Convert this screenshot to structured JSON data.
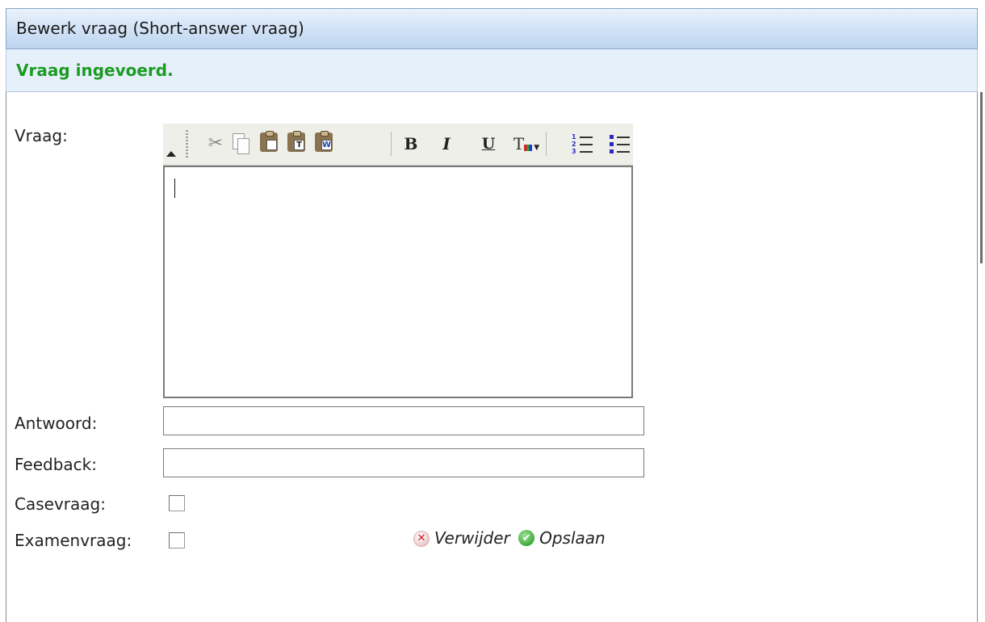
{
  "window": {
    "title": "Bewerk vraag (Short-answer vraag)"
  },
  "status": {
    "message": "Vraag ingevoerd.",
    "color": "#1c9b22"
  },
  "form": {
    "vraag_label": "Vraag:",
    "antwoord_label": "Antwoord:",
    "antwoord_value": "",
    "feedback_label": "Feedback:",
    "feedback_value": "",
    "casevraag_label": "Casevraag:",
    "casevraag_checked": false,
    "examenvraag_label": "Examenvraag:",
    "examenvraag_checked": false
  },
  "editor": {
    "content": "",
    "toolbar": {
      "collapse": "collapse-toolbar-icon",
      "cut": "cut-icon",
      "copy": "copy-icon",
      "paste": "paste-icon",
      "paste_text": "paste-text-icon",
      "paste_word": "paste-word-icon",
      "bold": "B",
      "italic": "I",
      "underline": "U",
      "text_color": "T",
      "ordered_list": "ordered-list-icon",
      "unordered_list": "unordered-list-icon"
    }
  },
  "actions": {
    "delete_label": "Verwijder",
    "save_label": "Opslaan",
    "delete_icon": "delete-icon",
    "save_icon": "save-check-icon",
    "delete_glyph": "✕",
    "save_glyph": "✔"
  },
  "colors": {
    "header_gradient_top": "#e9f2fc",
    "header_gradient_bottom": "#bcd4f0",
    "message_bg": "#e6f0fb"
  }
}
